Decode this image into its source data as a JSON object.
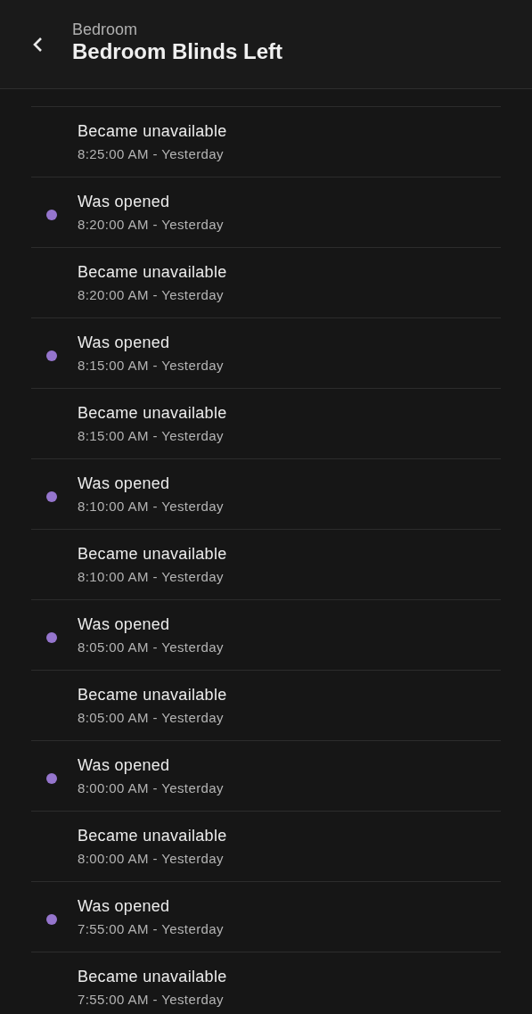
{
  "header": {
    "subtitle": "Bedroom",
    "title": "Bedroom Blinds Left"
  },
  "events": [
    {
      "message": "Became unavailable",
      "time": "8:25:00 AM - Yesterday"
    },
    {
      "message": "Was opened",
      "time": "8:20:00 AM - Yesterday",
      "color": "#9575cd"
    },
    {
      "message": "Became unavailable",
      "time": "8:20:00 AM - Yesterday"
    },
    {
      "message": "Was opened",
      "time": "8:15:00 AM - Yesterday",
      "color": "#9575cd"
    },
    {
      "message": "Became unavailable",
      "time": "8:15:00 AM - Yesterday"
    },
    {
      "message": "Was opened",
      "time": "8:10:00 AM - Yesterday",
      "color": "#9575cd"
    },
    {
      "message": "Became unavailable",
      "time": "8:10:00 AM - Yesterday"
    },
    {
      "message": "Was opened",
      "time": "8:05:00 AM - Yesterday",
      "color": "#9575cd"
    },
    {
      "message": "Became unavailable",
      "time": "8:05:00 AM - Yesterday"
    },
    {
      "message": "Was opened",
      "time": "8:00:00 AM - Yesterday",
      "color": "#9575cd"
    },
    {
      "message": "Became unavailable",
      "time": "8:00:00 AM - Yesterday"
    },
    {
      "message": "Was opened",
      "time": "7:55:00 AM - Yesterday",
      "color": "#9575cd"
    },
    {
      "message": "Became unavailable",
      "time": "7:55:00 AM - Yesterday"
    }
  ]
}
